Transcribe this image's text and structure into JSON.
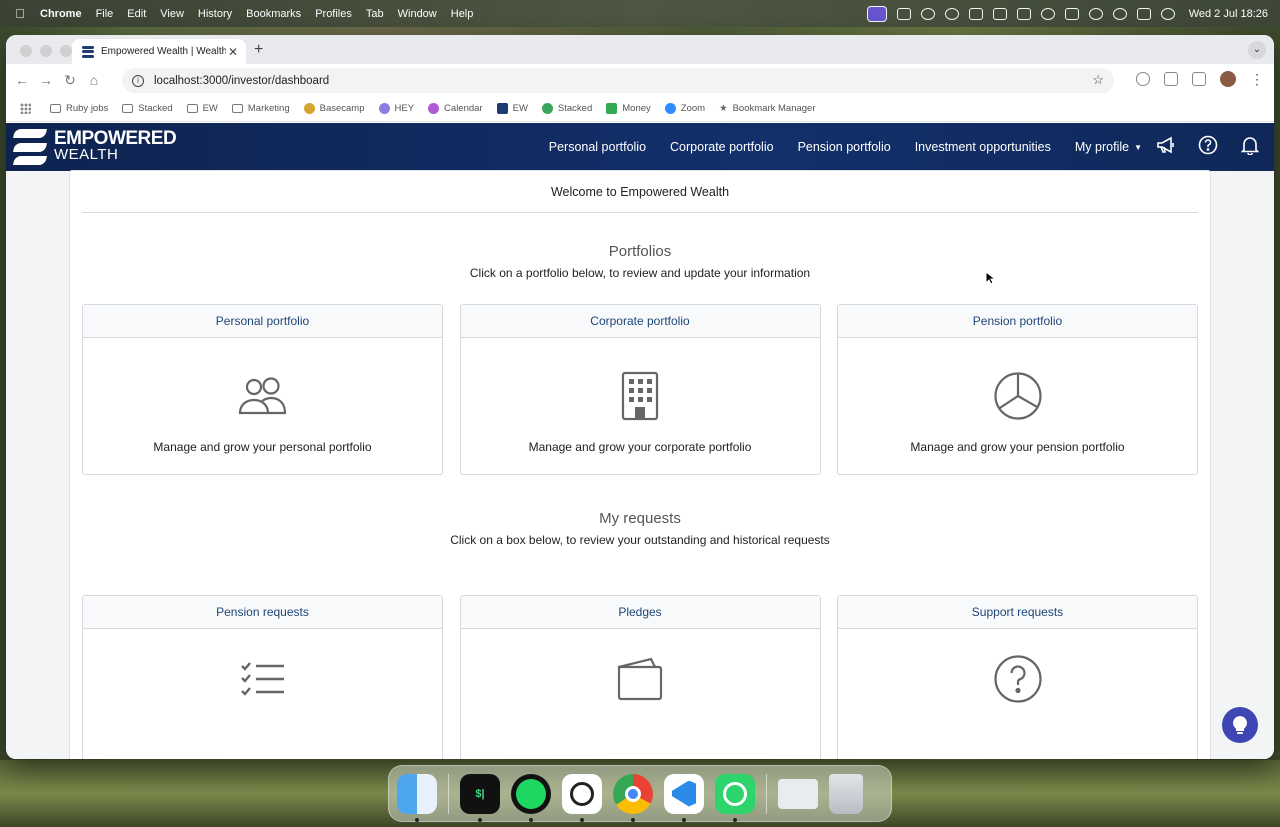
{
  "menubar": {
    "app": "Chrome",
    "items": [
      "File",
      "Edit",
      "View",
      "History",
      "Bookmarks",
      "Profiles",
      "Tab",
      "Window",
      "Help"
    ],
    "clock": "Wed 2 Jul  18:26"
  },
  "browser": {
    "tab_title": "Empowered Wealth | Wealth I",
    "url": "localhost:3000/investor/dashboard",
    "bookmarks": [
      "Ruby jobs",
      "Stacked",
      "EW",
      "Marketing",
      "Basecamp",
      "HEY",
      "Calendar",
      "EW",
      "Stacked",
      "Money",
      "Zoom",
      "Bookmark Manager"
    ]
  },
  "app": {
    "logo_line1": "EMPOWERED",
    "logo_line2": "WEALTH",
    "nav": [
      "Personal portfolio",
      "Corporate portfolio",
      "Pension portfolio",
      "Investment opportunities"
    ],
    "profile_label": "My profile",
    "welcome": "Welcome to Empowered Wealth",
    "portfolios": {
      "title": "Portfolios",
      "subtitle": "Click on a portfolio below, to review and update your information",
      "tiles": [
        {
          "title": "Personal portfolio",
          "text": "Manage and grow your personal portfolio",
          "icon": "people-icon"
        },
        {
          "title": "Corporate portfolio",
          "text": "Manage and grow your corporate portfolio",
          "icon": "building-icon"
        },
        {
          "title": "Pension portfolio",
          "text": "Manage and grow your pension portfolio",
          "icon": "pie-chart-icon"
        }
      ]
    },
    "requests": {
      "title": "My requests",
      "subtitle": "Click on a box below, to review your outstanding and historical requests",
      "tiles": [
        {
          "title": "Pension requests",
          "icon": "checklist-icon"
        },
        {
          "title": "Pledges",
          "icon": "wallet-icon"
        },
        {
          "title": "Support requests",
          "icon": "question-icon"
        }
      ]
    }
  },
  "colors": {
    "navbar": "#13306b",
    "tile_title": "#1f4677",
    "chat_button": "#3d46b3"
  }
}
